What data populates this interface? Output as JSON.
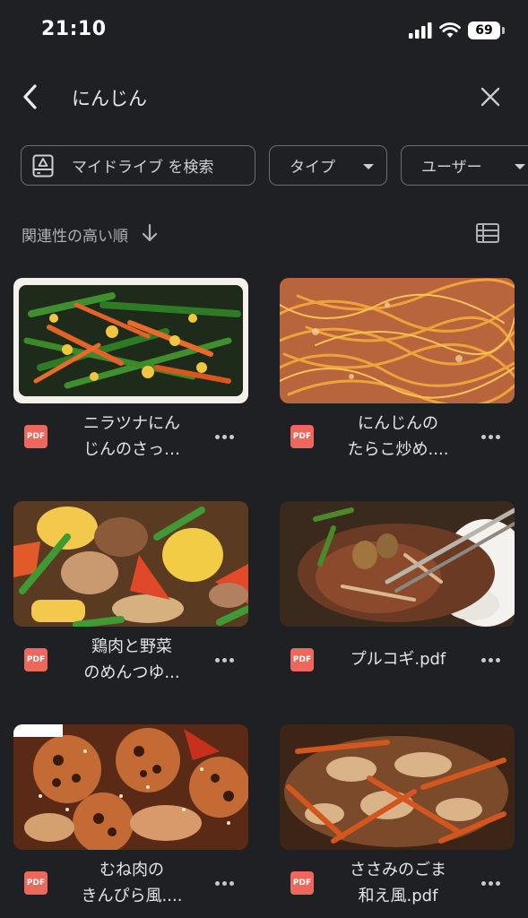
{
  "status_bar": {
    "time": "21:10",
    "battery": "69"
  },
  "search": {
    "query": "にんじん"
  },
  "filters": {
    "drive_chip": "マイドライブ を検索",
    "type_chip": "タイプ",
    "user_chip": "ユーザー"
  },
  "sort": {
    "label": "関連性の高い順"
  },
  "files": [
    {
      "type_badge": "PDF",
      "name_line1": "ニラツナにん",
      "name_line2": "じんのさっ…",
      "thumbnail": "nira-tuna-carrot-dish"
    },
    {
      "type_badge": "PDF",
      "name_line1": "にんじんの",
      "name_line2": "たらこ炒め....",
      "thumbnail": "carrot-tarako-stirfry"
    },
    {
      "type_badge": "PDF",
      "name_line1": "鶏肉と野菜",
      "name_line2": "のめんつゆ...",
      "thumbnail": "chicken-vegetable-stew"
    },
    {
      "type_badge": "PDF",
      "name_line1": "プルコギ.pdf",
      "name_line2": "",
      "thumbnail": "bulgogi-over-rice"
    },
    {
      "type_badge": "PDF",
      "name_line1": "むね肉の",
      "name_line2": "きんぴら風....",
      "thumbnail": "chicken-lotus-kinpira"
    },
    {
      "type_badge": "PDF",
      "name_line1": "ささみのごま",
      "name_line2": "和え風.pdf",
      "thumbnail": "sasami-sesame-carrot"
    }
  ]
}
